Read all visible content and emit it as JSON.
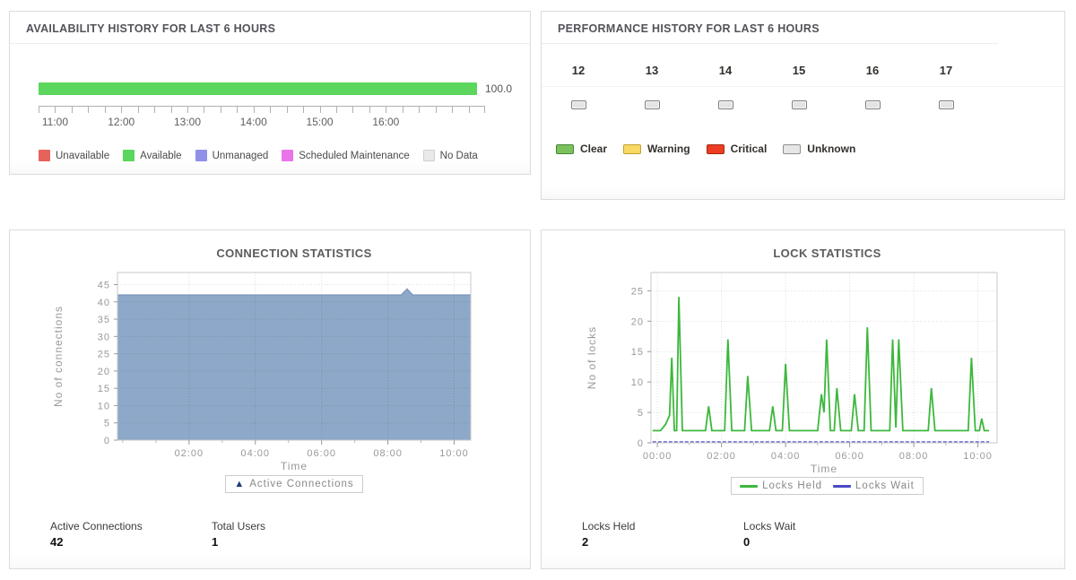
{
  "availability": {
    "title": "AVAILABILITY HISTORY FOR LAST 6 HOURS",
    "value_label": "100.0",
    "bar_color": "#5cd65c",
    "axis": {
      "ticks_total": 28,
      "hour_tick_indices": [
        1,
        5,
        9,
        13,
        17,
        21
      ],
      "hour_labels": [
        "11:00",
        "12:00",
        "13:00",
        "14:00",
        "15:00",
        "16:00"
      ]
    },
    "legend": [
      {
        "label": "Unavailable",
        "color": "#e8625c"
      },
      {
        "label": "Available",
        "color": "#5cd65c"
      },
      {
        "label": "Unmanaged",
        "color": "#9090e8"
      },
      {
        "label": "Scheduled Maintenance",
        "color": "#ea75ea"
      },
      {
        "label": "No Data",
        "color": "#e9e9e9"
      }
    ]
  },
  "performance": {
    "title": "PERFORMANCE HISTORY FOR LAST 6 HOURS",
    "hours": [
      "12",
      "13",
      "14",
      "15",
      "16",
      "17"
    ],
    "hour_status": [
      "Unknown",
      "Unknown",
      "Unknown",
      "Unknown",
      "Unknown",
      "Unknown"
    ],
    "status_box": {
      "fill": "#e3e3e3",
      "border": "#7f7f7f"
    },
    "legend": [
      {
        "label": "Clear",
        "fill": "#7cc25c",
        "border": "#44853a"
      },
      {
        "label": "Warning",
        "fill": "#f7d964",
        "border": "#c3a02f"
      },
      {
        "label": "Critical",
        "fill": "#ec3d22",
        "border": "#a22a14"
      },
      {
        "label": "Unknown",
        "fill": "#e6e6e6",
        "border": "#8f8f8f"
      }
    ]
  },
  "connection": {
    "stats": [
      {
        "label": "Active Connections",
        "value": "42"
      },
      {
        "label": "Total Users",
        "value": "1"
      }
    ]
  },
  "lock": {
    "stats": [
      {
        "label": "Locks Held",
        "value": "2"
      },
      {
        "label": "Locks Wait",
        "value": "0"
      }
    ]
  },
  "chart_data": [
    {
      "type": "area",
      "title": "CONNECTION STATISTICS",
      "xlabel": "Time",
      "ylabel": "No of connections",
      "xlim": [
        -0.16,
        10.5
      ],
      "ylim": [
        0,
        48.5
      ],
      "y_ticks": [
        0,
        5,
        10,
        15,
        20,
        25,
        30,
        35,
        40,
        45
      ],
      "x_ticks": [
        {
          "v": 2,
          "label": "02:00"
        },
        {
          "v": 4,
          "label": "04:00"
        },
        {
          "v": 6,
          "label": "06:00"
        },
        {
          "v": 8,
          "label": "08:00"
        },
        {
          "v": 10,
          "label": "10:00"
        }
      ],
      "minor_x": [
        0,
        1,
        3,
        5,
        7,
        9
      ],
      "grid": true,
      "series": [
        {
          "name": "Active Connections",
          "color": "#7e9abc",
          "fill": "#8da8c8",
          "points": [
            [
              -0.16,
              42
            ],
            [
              8.4,
              42
            ],
            [
              8.58,
              43.7
            ],
            [
              8.75,
              42
            ],
            [
              10.5,
              42
            ]
          ]
        }
      ],
      "legend": [
        {
          "label": "Active Connections",
          "marker": "triangle",
          "color": "#1e3c78"
        }
      ]
    },
    {
      "type": "line",
      "title": "LOCK STATISTICS",
      "xlabel": "Time",
      "ylabel": "No of locks",
      "xlim": [
        -0.2,
        10.6
      ],
      "ylim": [
        0,
        28
      ],
      "y_ticks": [
        0,
        5,
        10,
        15,
        20,
        25
      ],
      "x_ticks": [
        {
          "v": 0,
          "label": "00:00"
        },
        {
          "v": 2,
          "label": "02:00"
        },
        {
          "v": 4,
          "label": "04:00"
        },
        {
          "v": 6,
          "label": "06:00"
        },
        {
          "v": 8,
          "label": "08:00"
        },
        {
          "v": 10,
          "label": "10:00"
        }
      ],
      "minor_x": [
        1,
        3,
        5,
        7,
        9
      ],
      "grid": true,
      "series": [
        {
          "name": "Locks Held",
          "color": "#3cb83c",
          "width": 1.8,
          "points": [
            [
              -0.15,
              2
            ],
            [
              0.1,
              2
            ],
            [
              0.25,
              3
            ],
            [
              0.38,
              4.5
            ],
            [
              0.45,
              14
            ],
            [
              0.53,
              2
            ],
            [
              0.6,
              2
            ],
            [
              0.67,
              24
            ],
            [
              0.78,
              2
            ],
            [
              1.5,
              2
            ],
            [
              1.6,
              6
            ],
            [
              1.7,
              2
            ],
            [
              2.1,
              2
            ],
            [
              2.2,
              17
            ],
            [
              2.32,
              2
            ],
            [
              2.72,
              2
            ],
            [
              2.82,
              11
            ],
            [
              2.94,
              2
            ],
            [
              3.5,
              2
            ],
            [
              3.6,
              6
            ],
            [
              3.7,
              2
            ],
            [
              3.9,
              2
            ],
            [
              4.0,
              13
            ],
            [
              4.12,
              2
            ],
            [
              5.0,
              2
            ],
            [
              5.12,
              8
            ],
            [
              5.2,
              5
            ],
            [
              5.28,
              17
            ],
            [
              5.4,
              2
            ],
            [
              5.52,
              2
            ],
            [
              5.6,
              9
            ],
            [
              5.72,
              2
            ],
            [
              6.05,
              2
            ],
            [
              6.15,
              8
            ],
            [
              6.27,
              2
            ],
            [
              6.45,
              2
            ],
            [
              6.55,
              19
            ],
            [
              6.67,
              2
            ],
            [
              7.25,
              2
            ],
            [
              7.34,
              17
            ],
            [
              7.44,
              2.5
            ],
            [
              7.53,
              17
            ],
            [
              7.66,
              2
            ],
            [
              8.45,
              2
            ],
            [
              8.55,
              9
            ],
            [
              8.66,
              2
            ],
            [
              9.7,
              2
            ],
            [
              9.8,
              14
            ],
            [
              9.92,
              2
            ],
            [
              10.05,
              2
            ],
            [
              10.12,
              4
            ],
            [
              10.2,
              2
            ],
            [
              10.35,
              2
            ]
          ]
        },
        {
          "name": "Locks Wait",
          "color": "#6b6bdb",
          "width": 1.8,
          "dash": "4 2",
          "points": [
            [
              -0.15,
              0.15
            ],
            [
              10.35,
              0.15
            ]
          ]
        }
      ],
      "legend": [
        {
          "label": "Locks Held",
          "marker": "line",
          "color": "#3cb83c"
        },
        {
          "label": "Locks Wait",
          "marker": "line",
          "color": "#4949c8"
        }
      ]
    }
  ]
}
